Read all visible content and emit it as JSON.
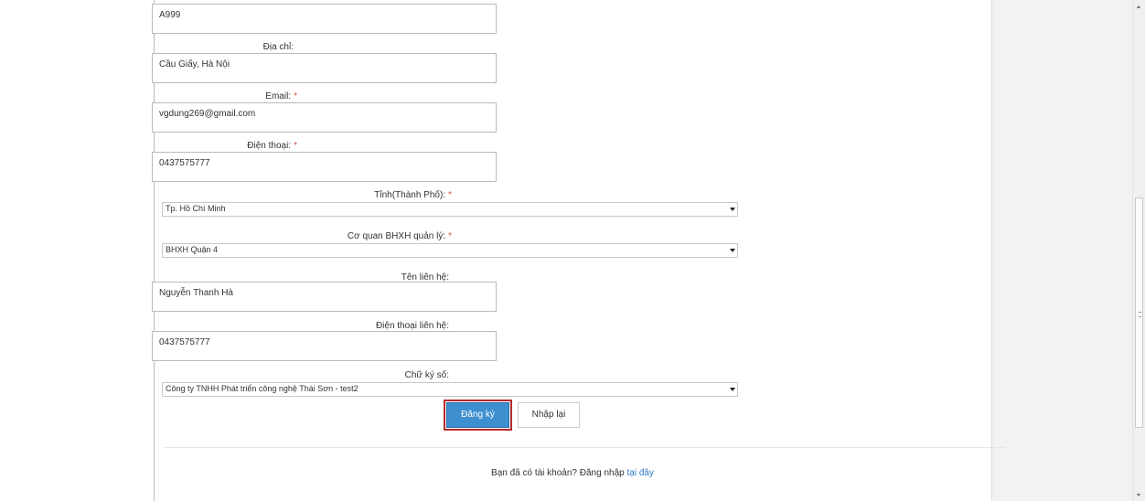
{
  "form": {
    "code_value": "A999",
    "address": {
      "label": "Địa chỉ:",
      "value": "Cầu Giấy, Hà Nội"
    },
    "email": {
      "label": "Email:",
      "required": "*",
      "value": "vgdung269@gmail.com"
    },
    "phone": {
      "label": "Điện thoại:",
      "required": "*",
      "value": "0437575777"
    },
    "province": {
      "label": "Tỉnh(Thành Phố):",
      "required": "*",
      "value": "Tp. Hồ Chí Minh"
    },
    "agency": {
      "label": "Cơ quan BHXH quản lý:",
      "required": "*",
      "value": "BHXH Quận 4"
    },
    "contact_name": {
      "label": "Tên liên hệ:",
      "value": "Nguyễn Thanh Hà"
    },
    "contact_phone": {
      "label": "Điện thoại liên hệ:",
      "value": "0437575777"
    },
    "signature": {
      "label": "Chữ ký số:",
      "value": "Công ty TNHH Phát triển công nghệ Thái Sơn - test2"
    }
  },
  "buttons": {
    "register": "Đăng ký",
    "reset": "Nhập lại"
  },
  "footer": {
    "text": "Bạn đã có tài khoản? Đăng nhập",
    "link": "tại đây"
  },
  "colors": {
    "primary": "#3d8fd0",
    "highlight": "#b22b2b",
    "required": "#d9534f",
    "link": "#2b78c5"
  }
}
